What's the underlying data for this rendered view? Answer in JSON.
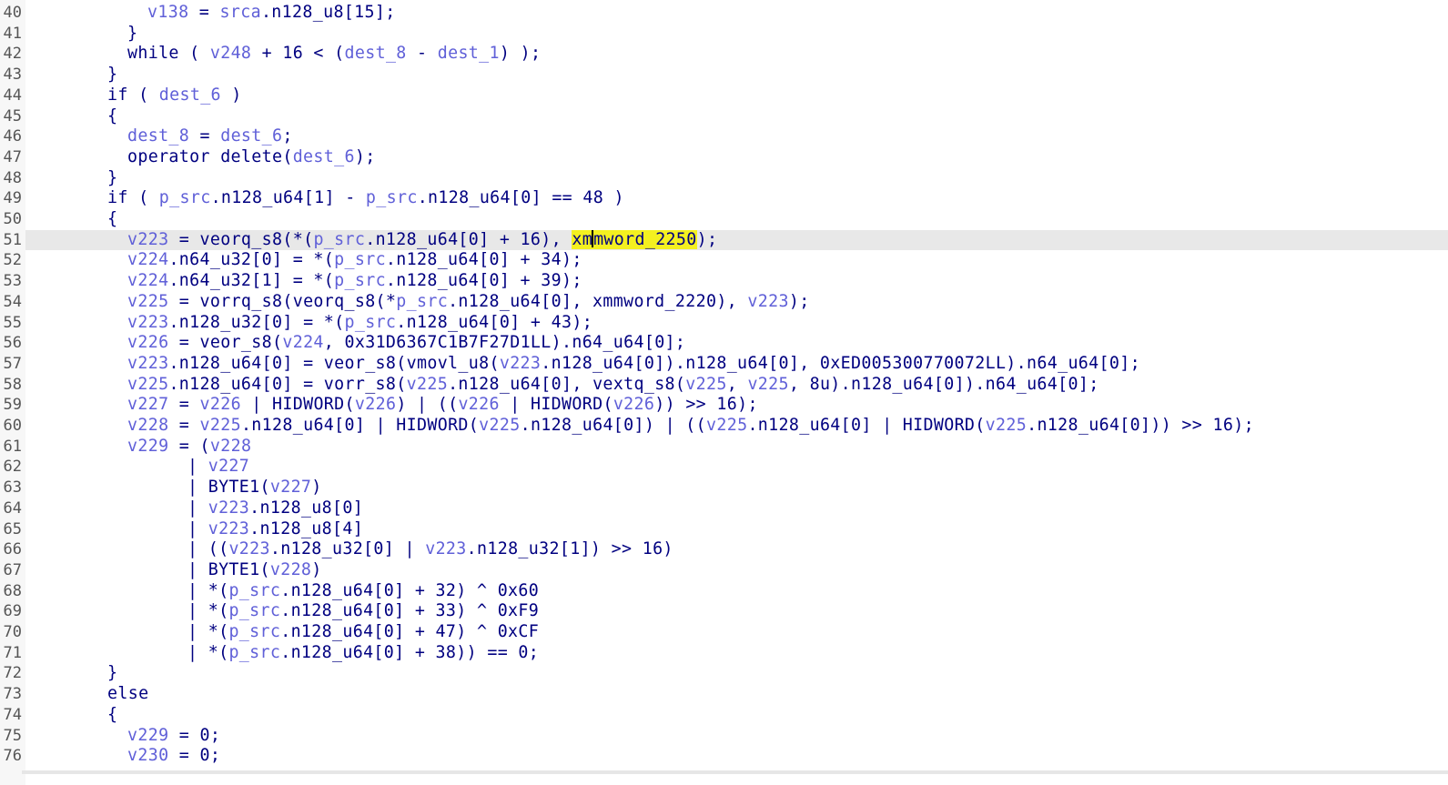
{
  "editor": {
    "current_line_index": 11,
    "caret_after_text": "xm",
    "highlight_token": "xmmword_2250",
    "lines": [
      {
        "number": "40",
        "indent": 6,
        "code": [
          {
            "t": "v138",
            "c": "var"
          },
          {
            "t": " = "
          },
          {
            "t": "srca",
            "c": "var"
          },
          {
            "t": ".n128_u8[15];"
          }
        ]
      },
      {
        "number": "41",
        "indent": 5,
        "code": [
          {
            "t": "}"
          }
        ]
      },
      {
        "number": "42",
        "indent": 5,
        "code": [
          {
            "t": "while ( "
          },
          {
            "t": "v248",
            "c": "var"
          },
          {
            "t": " + 16 < ("
          },
          {
            "t": "dest_8",
            "c": "var"
          },
          {
            "t": " - "
          },
          {
            "t": "dest_1",
            "c": "var"
          },
          {
            "t": ") );"
          }
        ]
      },
      {
        "number": "43",
        "indent": 4,
        "code": [
          {
            "t": "}"
          }
        ]
      },
      {
        "number": "44",
        "indent": 4,
        "code": [
          {
            "t": "if ( "
          },
          {
            "t": "dest_6",
            "c": "var"
          },
          {
            "t": " )"
          }
        ]
      },
      {
        "number": "45",
        "indent": 4,
        "code": [
          {
            "t": "{"
          }
        ]
      },
      {
        "number": "46",
        "indent": 5,
        "code": [
          {
            "t": "dest_8",
            "c": "var"
          },
          {
            "t": " = "
          },
          {
            "t": "dest_6",
            "c": "var"
          },
          {
            "t": ";"
          }
        ]
      },
      {
        "number": "47",
        "indent": 5,
        "code": [
          {
            "t": "operator delete("
          },
          {
            "t": "dest_6",
            "c": "var"
          },
          {
            "t": ");"
          }
        ]
      },
      {
        "number": "48",
        "indent": 4,
        "code": [
          {
            "t": "}"
          }
        ]
      },
      {
        "number": "49",
        "indent": 4,
        "code": [
          {
            "t": "if ( "
          },
          {
            "t": "p_src",
            "c": "var"
          },
          {
            "t": ".n128_u64[1] - "
          },
          {
            "t": "p_src",
            "c": "var"
          },
          {
            "t": ".n128_u64[0] == 48 )"
          }
        ]
      },
      {
        "number": "50",
        "indent": 4,
        "code": [
          {
            "t": "{"
          }
        ]
      },
      {
        "number": "51",
        "indent": 5,
        "code": [
          {
            "t": "v223",
            "c": "var"
          },
          {
            "t": " = veorq_s8(*("
          },
          {
            "t": "p_src",
            "c": "var"
          },
          {
            "t": ".n128_u64[0] + 16), "
          },
          {
            "t": "xmmword_2250",
            "c": "hl"
          },
          {
            "t": ");"
          }
        ]
      },
      {
        "number": "52",
        "indent": 5,
        "code": [
          {
            "t": "v224",
            "c": "var"
          },
          {
            "t": ".n64_u32[0] = *("
          },
          {
            "t": "p_src",
            "c": "var"
          },
          {
            "t": ".n128_u64[0] + 34);"
          }
        ]
      },
      {
        "number": "53",
        "indent": 5,
        "code": [
          {
            "t": "v224",
            "c": "var"
          },
          {
            "t": ".n64_u32[1] = *("
          },
          {
            "t": "p_src",
            "c": "var"
          },
          {
            "t": ".n128_u64[0] + 39);"
          }
        ]
      },
      {
        "number": "54",
        "indent": 5,
        "code": [
          {
            "t": "v225",
            "c": "var"
          },
          {
            "t": " = vorrq_s8(veorq_s8(*"
          },
          {
            "t": "p_src",
            "c": "var"
          },
          {
            "t": ".n128_u64[0], xmmword_2220), "
          },
          {
            "t": "v223",
            "c": "var"
          },
          {
            "t": ");"
          }
        ]
      },
      {
        "number": "55",
        "indent": 5,
        "code": [
          {
            "t": "v223",
            "c": "var"
          },
          {
            "t": ".n128_u32[0] = *("
          },
          {
            "t": "p_src",
            "c": "var"
          },
          {
            "t": ".n128_u64[0] + 43);"
          }
        ]
      },
      {
        "number": "56",
        "indent": 5,
        "code": [
          {
            "t": "v226",
            "c": "var"
          },
          {
            "t": " = veor_s8("
          },
          {
            "t": "v224",
            "c": "var"
          },
          {
            "t": ", 0x31D6367C1B7F27D1LL).n64_u64[0];"
          }
        ]
      },
      {
        "number": "57",
        "indent": 5,
        "code": [
          {
            "t": "v223",
            "c": "var"
          },
          {
            "t": ".n128_u64[0] = veor_s8(vmovl_u8("
          },
          {
            "t": "v223",
            "c": "var"
          },
          {
            "t": ".n128_u64[0]).n128_u64[0], 0xED005300770072LL).n64_u64[0];"
          }
        ]
      },
      {
        "number": "58",
        "indent": 5,
        "code": [
          {
            "t": "v225",
            "c": "var"
          },
          {
            "t": ".n128_u64[0] = vorr_s8("
          },
          {
            "t": "v225",
            "c": "var"
          },
          {
            "t": ".n128_u64[0], vextq_s8("
          },
          {
            "t": "v225",
            "c": "var"
          },
          {
            "t": ", "
          },
          {
            "t": "v225",
            "c": "var"
          },
          {
            "t": ", 8u).n128_u64[0]).n64_u64[0];"
          }
        ]
      },
      {
        "number": "59",
        "indent": 5,
        "code": [
          {
            "t": "v227",
            "c": "var"
          },
          {
            "t": " = "
          },
          {
            "t": "v226",
            "c": "var"
          },
          {
            "t": " | HIDWORD("
          },
          {
            "t": "v226",
            "c": "var"
          },
          {
            "t": ") | (("
          },
          {
            "t": "v226",
            "c": "var"
          },
          {
            "t": " | HIDWORD("
          },
          {
            "t": "v226",
            "c": "var"
          },
          {
            "t": ")) >> 16);"
          }
        ]
      },
      {
        "number": "60",
        "indent": 5,
        "code": [
          {
            "t": "v228",
            "c": "var"
          },
          {
            "t": " = "
          },
          {
            "t": "v225",
            "c": "var"
          },
          {
            "t": ".n128_u64[0] | HIDWORD("
          },
          {
            "t": "v225",
            "c": "var"
          },
          {
            "t": ".n128_u64[0]) | (("
          },
          {
            "t": "v225",
            "c": "var"
          },
          {
            "t": ".n128_u64[0] | HIDWORD("
          },
          {
            "t": "v225",
            "c": "var"
          },
          {
            "t": ".n128_u64[0])) >> 16);"
          }
        ]
      },
      {
        "number": "61",
        "indent": 5,
        "code": [
          {
            "t": "v229",
            "c": "var"
          },
          {
            "t": " = ("
          },
          {
            "t": "v228",
            "c": "var"
          }
        ]
      },
      {
        "number": "62",
        "indent": 8,
        "code": [
          {
            "t": "| "
          },
          {
            "t": "v227",
            "c": "var"
          }
        ]
      },
      {
        "number": "63",
        "indent": 8,
        "code": [
          {
            "t": "| BYTE1("
          },
          {
            "t": "v227",
            "c": "var"
          },
          {
            "t": ")"
          }
        ]
      },
      {
        "number": "64",
        "indent": 8,
        "code": [
          {
            "t": "| "
          },
          {
            "t": "v223",
            "c": "var"
          },
          {
            "t": ".n128_u8[0]"
          }
        ]
      },
      {
        "number": "65",
        "indent": 8,
        "code": [
          {
            "t": "| "
          },
          {
            "t": "v223",
            "c": "var"
          },
          {
            "t": ".n128_u8[4]"
          }
        ]
      },
      {
        "number": "66",
        "indent": 8,
        "code": [
          {
            "t": "| (("
          },
          {
            "t": "v223",
            "c": "var"
          },
          {
            "t": ".n128_u32[0] | "
          },
          {
            "t": "v223",
            "c": "var"
          },
          {
            "t": ".n128_u32[1]) >> 16)"
          }
        ]
      },
      {
        "number": "67",
        "indent": 8,
        "code": [
          {
            "t": "| BYTE1("
          },
          {
            "t": "v228",
            "c": "var"
          },
          {
            "t": ")"
          }
        ]
      },
      {
        "number": "68",
        "indent": 8,
        "code": [
          {
            "t": "| *("
          },
          {
            "t": "p_src",
            "c": "var"
          },
          {
            "t": ".n128_u64[0] + 32) ^ 0x60"
          }
        ]
      },
      {
        "number": "69",
        "indent": 8,
        "code": [
          {
            "t": "| *("
          },
          {
            "t": "p_src",
            "c": "var"
          },
          {
            "t": ".n128_u64[0] + 33) ^ 0xF9"
          }
        ]
      },
      {
        "number": "70",
        "indent": 8,
        "code": [
          {
            "t": "| *("
          },
          {
            "t": "p_src",
            "c": "var"
          },
          {
            "t": ".n128_u64[0] + 47) ^ 0xCF"
          }
        ]
      },
      {
        "number": "71",
        "indent": 8,
        "code": [
          {
            "t": "| *("
          },
          {
            "t": "p_src",
            "c": "var"
          },
          {
            "t": ".n128_u64[0] + 38)) == 0;"
          }
        ]
      },
      {
        "number": "72",
        "indent": 4,
        "code": [
          {
            "t": "}"
          }
        ]
      },
      {
        "number": "73",
        "indent": 4,
        "code": [
          {
            "t": "else"
          }
        ]
      },
      {
        "number": "74",
        "indent": 4,
        "code": [
          {
            "t": "{"
          }
        ]
      },
      {
        "number": "75",
        "indent": 5,
        "code": [
          {
            "t": "v229",
            "c": "var"
          },
          {
            "t": " = 0;"
          }
        ]
      },
      {
        "number": "76",
        "indent": 5,
        "code": [
          {
            "t": "v230",
            "c": "var"
          },
          {
            "t": " = 0;"
          }
        ]
      }
    ]
  }
}
